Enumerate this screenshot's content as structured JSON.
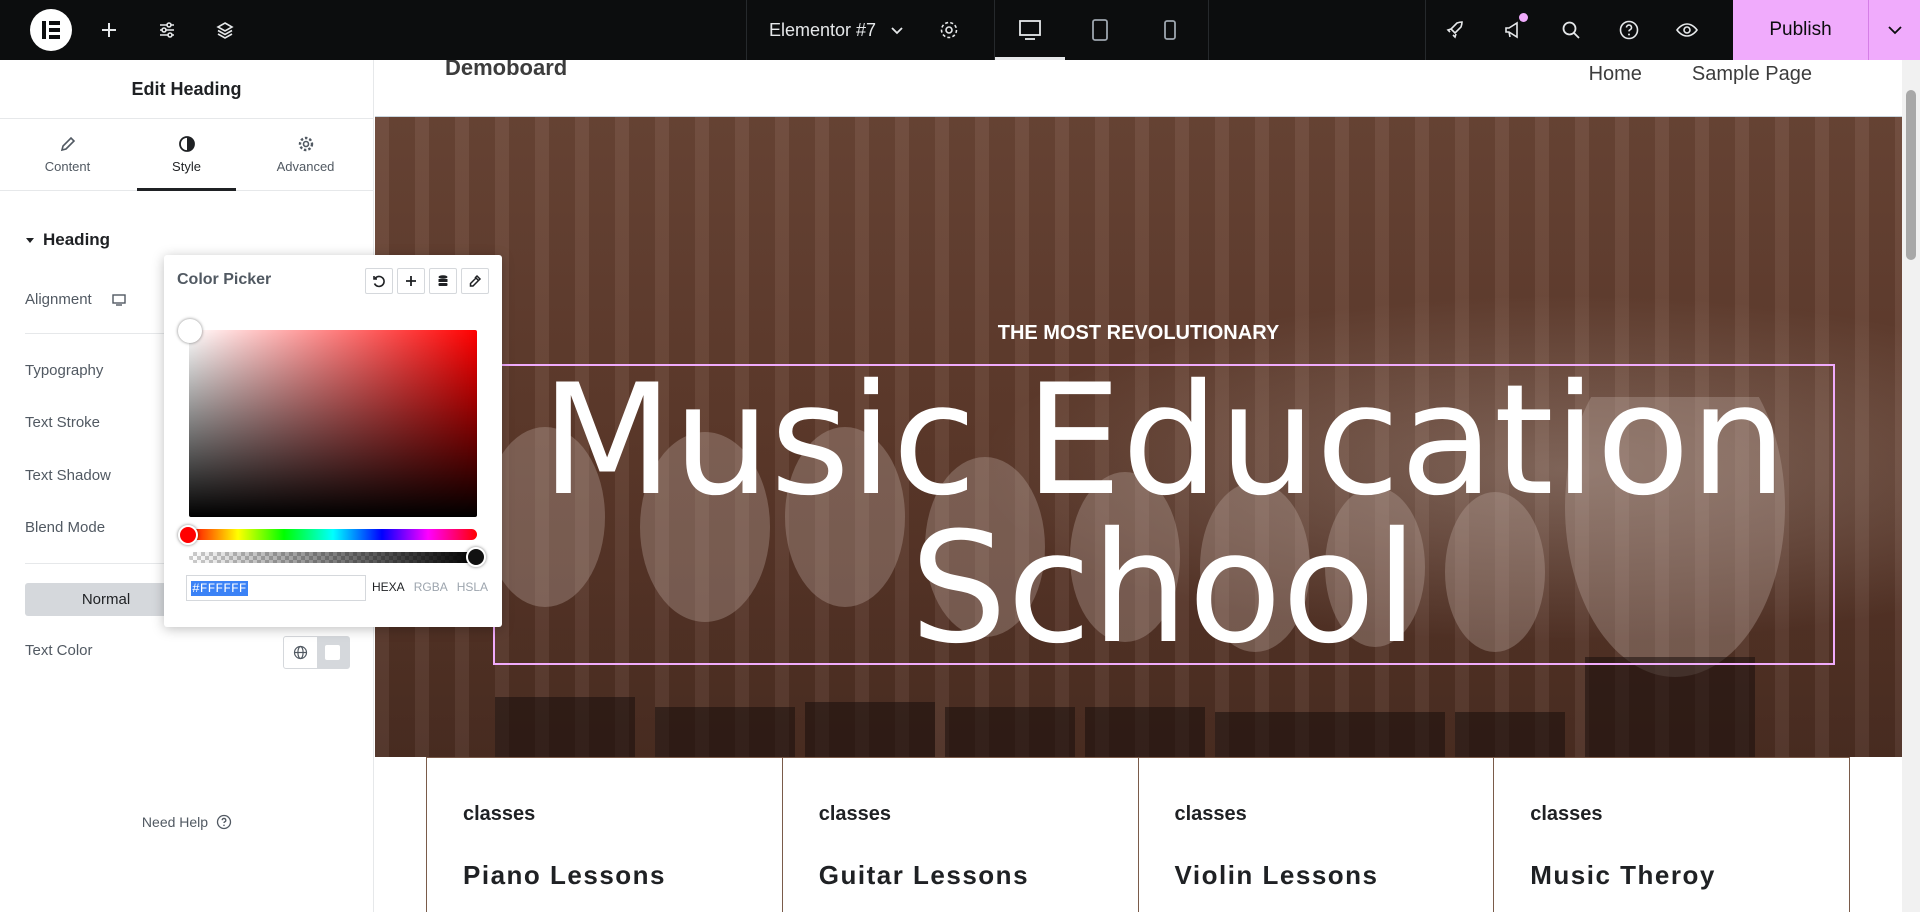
{
  "topbar": {
    "document_title": "Elementor #7",
    "publish_label": "Publish"
  },
  "panel": {
    "title": "Edit Heading",
    "tabs": [
      {
        "label": "Content"
      },
      {
        "label": "Style"
      },
      {
        "label": "Advanced"
      }
    ],
    "section": "Heading",
    "controls": {
      "alignment": "Alignment",
      "typography": "Typography",
      "text_stroke": "Text Stroke",
      "text_shadow": "Text Shadow",
      "blend_mode": "Blend Mode",
      "normal": "Normal",
      "text_color": "Text Color"
    },
    "need_help": "Need Help"
  },
  "color_picker": {
    "title": "Color Picker",
    "hex_value": "#FFFFFF",
    "modes": [
      "HEXA",
      "RGBA",
      "HSLA"
    ],
    "selected_mode": "HEXA",
    "hue": "#ff0000"
  },
  "site": {
    "logo": "Demoboard",
    "nav": [
      "Home",
      "Sample Page"
    ],
    "eyebrow": "THE MOST REVOLUTIONARY",
    "heading_line1": "Music Education",
    "heading_line2": "School",
    "cards": [
      {
        "kicker": "classes",
        "title": "Piano Lessons"
      },
      {
        "kicker": "classes",
        "title": "Guitar Lessons"
      },
      {
        "kicker": "classes",
        "title": "Violin Lessons"
      },
      {
        "kicker": "classes",
        "title": "Music Theroy"
      }
    ]
  },
  "colors": {
    "accent": "#f0abfc",
    "topbar": "#0c0d0e"
  }
}
